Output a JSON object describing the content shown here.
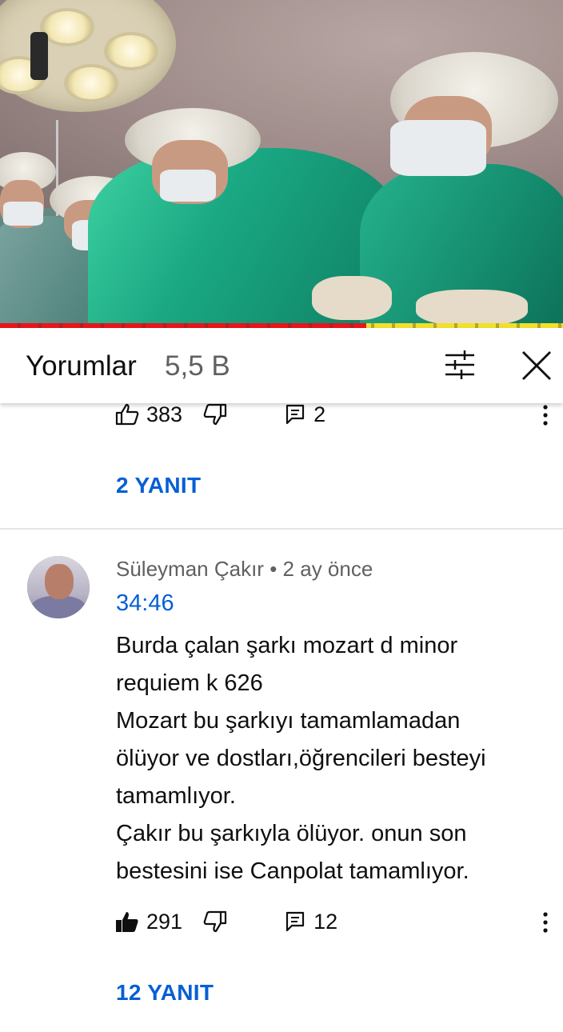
{
  "header": {
    "title": "Yorumlar",
    "count": "5,5 B"
  },
  "first_comment_actions": {
    "likes": "383",
    "replies": "2",
    "replies_link": "2 YANIT"
  },
  "comment": {
    "author": "Süleyman Çakır",
    "separator": "•",
    "time": "2 ay önce",
    "timestamp_link": "34:46",
    "lines": [
      "Burda çalan şarkı mozart d minor",
      "requiem k 626",
      "Mozart bu şarkıyı tamamlamadan",
      "ölüyor ve dostları,öğrencileri besteyi",
      "tamamlıyor.",
      "Çakır bu şarkıyla ölüyor. onun son",
      "bestesini ise Canpolat tamamlıyor."
    ],
    "likes": "291",
    "replies": "12",
    "replies_link": "12 YANIT"
  },
  "video": {
    "progress": 0.65
  },
  "colors": {
    "link_blue": "#065fd4",
    "progress_red": "#e8151b",
    "progress_yellow": "#f2e02a",
    "text_secondary": "#606060"
  },
  "icons": [
    "filter-icon",
    "close-icon",
    "thumbs-up-icon",
    "thumbs-down-icon",
    "comment-icon",
    "more-vert-icon"
  ]
}
